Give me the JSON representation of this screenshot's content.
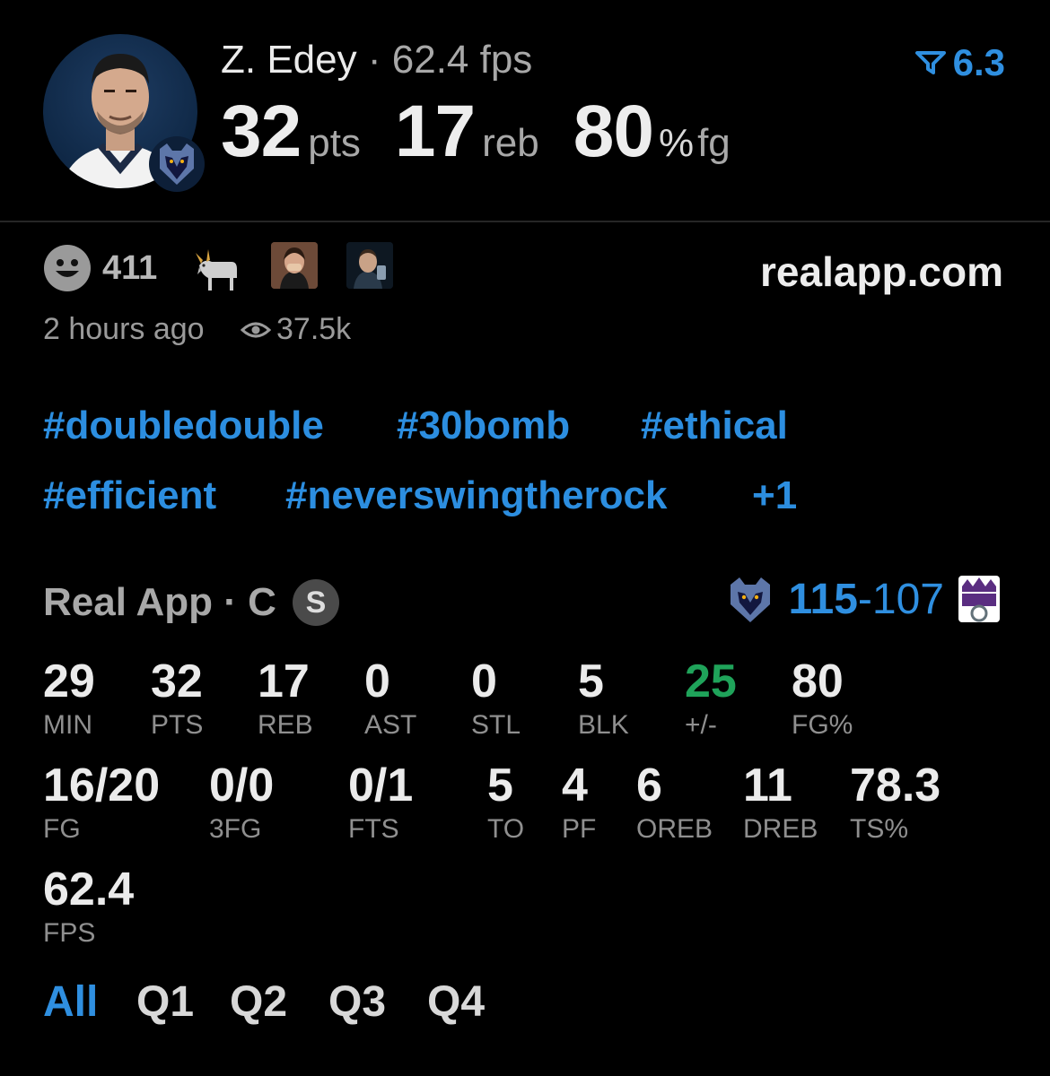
{
  "player": {
    "name": "Z. Edey",
    "separator": "·",
    "fps": "62.4 fps",
    "pts": "32",
    "pts_unit": "pts",
    "reb": "17",
    "reb_unit": "reb",
    "fg": "80",
    "fg_unit_pct": "%",
    "fg_unit": "fg",
    "rating": "6.3",
    "rating_icon": "filter-icon"
  },
  "reactions": {
    "count": "411",
    "time": "2 hours ago",
    "views": "37.5k",
    "site": "realapp.com"
  },
  "hashtags": [
    "#doubledouble",
    "#30bomb",
    "#ethical",
    "#efficient",
    "#neverswingtherock",
    "+1"
  ],
  "game": {
    "source": "Real App · C",
    "badge": "S",
    "home_score": "115",
    "dash": "-",
    "away_score": "107"
  },
  "stats_row1": [
    {
      "value": "29",
      "label": "MIN"
    },
    {
      "value": "32",
      "label": "PTS"
    },
    {
      "value": "17",
      "label": "REB"
    },
    {
      "value": "0",
      "label": "AST"
    },
    {
      "value": "0",
      "label": "STL"
    },
    {
      "value": "5",
      "label": "BLK"
    },
    {
      "value": "25",
      "label": "+/-"
    },
    {
      "value": "80",
      "label": "FG%"
    }
  ],
  "stats_row2": [
    {
      "value": "16/20",
      "label": "FG"
    },
    {
      "value": "0/0",
      "label": "3FG"
    },
    {
      "value": "0/1",
      "label": "FTS"
    },
    {
      "value": "5",
      "label": "TO"
    },
    {
      "value": "4",
      "label": "PF"
    },
    {
      "value": "6",
      "label": "OREB"
    },
    {
      "value": "11",
      "label": "DREB"
    },
    {
      "value": "78.3",
      "label": "TS%"
    }
  ],
  "stats_row3": [
    {
      "value": "62.4",
      "label": "FPS"
    }
  ],
  "quarters": [
    "All",
    "Q1",
    "Q2",
    "Q3",
    "Q4"
  ],
  "colors": {
    "accent": "#2f8fe0",
    "positive": "#1fa35a",
    "background": "#000000"
  }
}
